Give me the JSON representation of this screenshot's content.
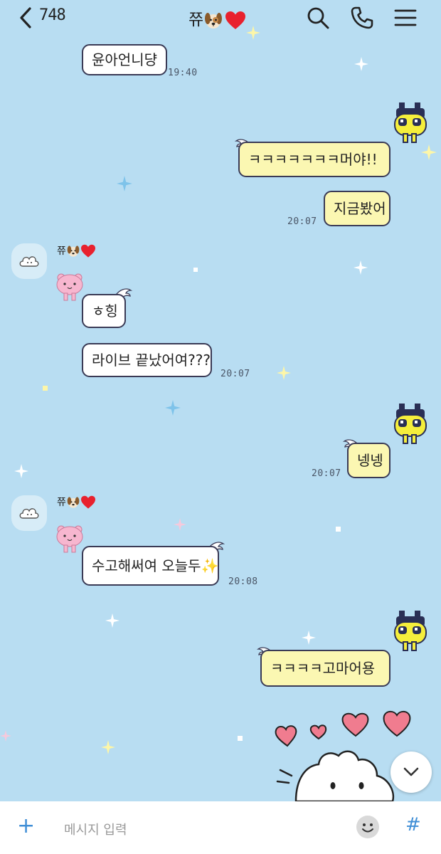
{
  "header": {
    "unread_count": "748",
    "title_text": "쮸",
    "back_icon": "chevron-left-icon",
    "search_icon": "search-icon",
    "call_icon": "phone-icon",
    "menu_icon": "hamburger-menu-icon"
  },
  "messages": [
    {
      "side": "in",
      "text": "윤아언니댱",
      "time": "19:40"
    },
    {
      "side": "out",
      "text": "ㅋㅋㅋㅋㅋㅋㅋ머야!!",
      "time": ""
    },
    {
      "side": "out",
      "text": "지금봤어",
      "time": "20:07"
    },
    {
      "side": "in",
      "sender": "쮸",
      "text": "ㅎ힝",
      "time": ""
    },
    {
      "side": "in",
      "text": "라이브 끝났어여???",
      "time": "20:07"
    },
    {
      "side": "out",
      "text": "넹넹",
      "time": "20:07"
    },
    {
      "side": "in",
      "sender": "쮸",
      "text": "수고해써여 오늘두✨",
      "time": "20:08"
    },
    {
      "side": "out",
      "text": "ㅋㅋㅋㅋ고마어용",
      "time": ""
    }
  ],
  "input": {
    "placeholder": "메시지 입력",
    "plus_label": "+",
    "hash_label": "#"
  },
  "colors": {
    "background": "#b8ddf2",
    "outgoing_bubble": "#fbf7b2",
    "incoming_bubble": "#ffffff",
    "accent": "#3f8ed6"
  }
}
